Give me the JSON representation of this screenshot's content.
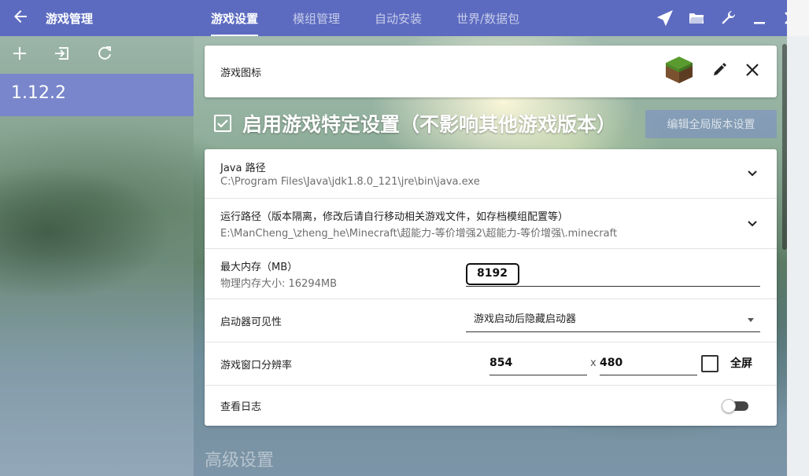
{
  "header": {
    "back_icon": "arrow-left-icon",
    "title": "游戏管理",
    "tabs": [
      {
        "label": "游戏设置",
        "active": true
      },
      {
        "label": "模组管理",
        "active": false
      },
      {
        "label": "自动安装",
        "active": false
      },
      {
        "label": "世界/数据包",
        "active": false
      }
    ],
    "tool_icons": [
      "paper-plane-icon",
      "folder-icon",
      "wrench-icon",
      "minimize-icon",
      "close-icon"
    ]
  },
  "sidebar": {
    "tools": [
      "add-icon",
      "import-icon",
      "refresh-icon"
    ],
    "versions": [
      {
        "label": "1.12.2",
        "selected": true
      }
    ]
  },
  "icon_card": {
    "label": "游戏图标",
    "icons": [
      "grass-block-icon",
      "edit-icon",
      "close-icon"
    ]
  },
  "enable_specific": {
    "checked": true,
    "text": "启用游戏特定设置（不影响其他游戏版本）",
    "global_button": "编辑全局版本设置"
  },
  "settings": {
    "java_path": {
      "title": "Java 路径",
      "value": "C:\\Program Files\\Java\\jdk1.8.0_121\\jre\\bin\\java.exe"
    },
    "run_path": {
      "title": "运行路径（版本隔离，修改后请自行移动相关游戏文件，如存档模组配置等）",
      "value": "E:\\ManCheng_\\zheng_he\\Minecraft\\超能力-等价增强2\\超能力-等价增强\\.minecraft"
    },
    "max_memory": {
      "title": "最大内存（MB）",
      "sub": "物理内存大小: 16294MB",
      "value": "8192"
    },
    "launcher_visibility": {
      "title": "启动器可见性",
      "value": "游戏启动后隐藏启动器"
    },
    "resolution": {
      "title": "游戏窗口分辨率",
      "width": "854",
      "sep": "x",
      "height": "480",
      "fullscreen_label": "全屏",
      "fullscreen": false
    },
    "show_log": {
      "title": "查看日志",
      "enabled": false
    }
  },
  "advanced_title": "高级设置",
  "colors": {
    "primary": "#5c6bc0",
    "selected": "#7986cb"
  }
}
